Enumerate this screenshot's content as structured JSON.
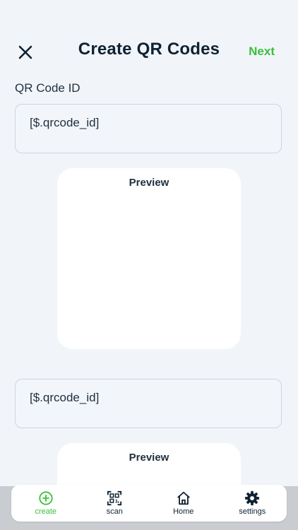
{
  "header": {
    "title": "Create QR Codes",
    "next_label": "Next"
  },
  "form": {
    "qr_label": "QR Code ID",
    "first_value": "[$.qrcode_id]",
    "second_value": "[$.qrcode_id]"
  },
  "previews": [
    {
      "label": "Preview"
    },
    {
      "label": "Preview"
    }
  ],
  "nav": {
    "items": [
      {
        "label": "create",
        "icon": "plus-circle-icon",
        "active": true
      },
      {
        "label": "scan",
        "icon": "qr-scan-icon",
        "active": false
      },
      {
        "label": "Home",
        "icon": "home-icon",
        "active": false
      },
      {
        "label": "settings",
        "icon": "gear-icon",
        "active": false
      }
    ]
  },
  "colors": {
    "accent": "#3bbf3b",
    "text": "#0f2233",
    "background": "#f1f4f9"
  }
}
